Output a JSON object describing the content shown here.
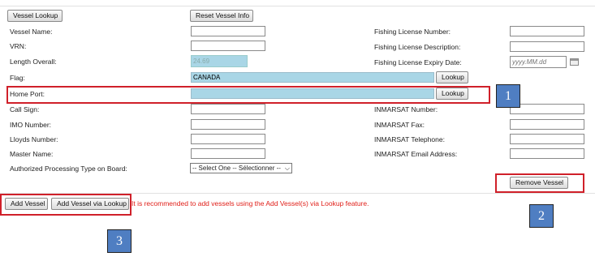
{
  "toolbar": {
    "vessel_lookup": "Vessel Lookup",
    "reset_vessel_info": "Reset Vessel Info"
  },
  "left_fields": {
    "vessel_name": {
      "label": "Vessel Name:",
      "value": ""
    },
    "vrn": {
      "label": "VRN:",
      "value": ""
    },
    "length_overall": {
      "label": "Length Overall:",
      "value": "24.69"
    },
    "flag": {
      "label": "Flag:",
      "value": "CANADA",
      "lookup": "Lookup"
    },
    "home_port": {
      "label": "Home Port:",
      "value": "",
      "lookup": "Lookup"
    },
    "call_sign": {
      "label": "Call Sign:",
      "value": ""
    },
    "imo_number": {
      "label": "IMO Number:",
      "value": ""
    },
    "lloyds_number": {
      "label": "Lloyds Number:",
      "value": ""
    },
    "master_name": {
      "label": "Master Name:",
      "value": ""
    },
    "processing_type": {
      "label": "Authorized Processing Type on Board:",
      "value": "-- Select One -- Sélectionner --"
    }
  },
  "right_fields": {
    "fishing_license_number": {
      "label": "Fishing License Number:",
      "value": ""
    },
    "fishing_license_description": {
      "label": "Fishing License Description:",
      "value": ""
    },
    "fishing_license_expiry": {
      "label": "Fishing License Expiry Date:",
      "placeholder": "yyyy.MM.dd"
    },
    "inmarsat_number": {
      "label": "INMARSAT Number:",
      "value": ""
    },
    "inmarsat_fax": {
      "label": "INMARSAT Fax:",
      "value": ""
    },
    "inmarsat_telephone": {
      "label": "INMARSAT Telephone:",
      "value": ""
    },
    "inmarsat_email": {
      "label": "INMARSAT Email Address:",
      "value": ""
    }
  },
  "actions": {
    "remove_vessel": "Remove Vessel",
    "add_vessel": "Add Vessel",
    "add_vessel_via_lookup": "Add Vessel via Lookup",
    "note": "It is recommended to add vessels using the Add Vessel(s) via Lookup feature."
  },
  "callouts": {
    "one": "1",
    "two": "2",
    "three": "3"
  },
  "colors": {
    "highlight": "#d0202a",
    "badge": "#4f7ec2",
    "readonly_field": "#a9d6e6"
  }
}
